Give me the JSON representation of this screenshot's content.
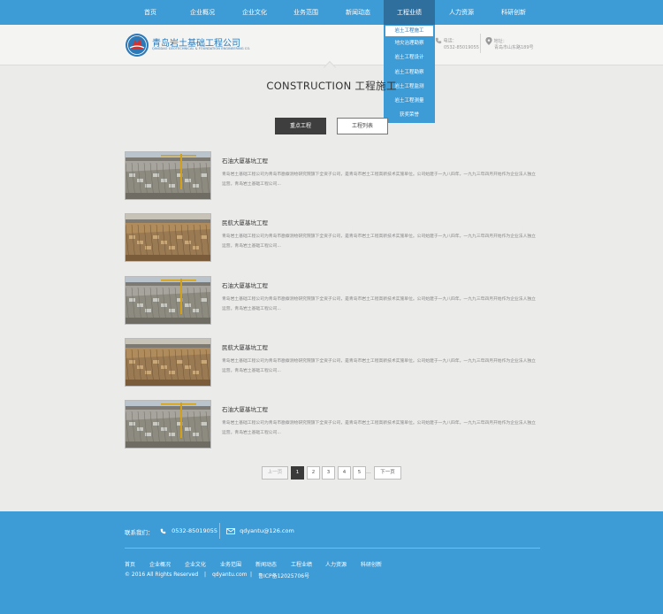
{
  "nav": {
    "items": [
      "首页",
      "企业概况",
      "企业文化",
      "业务范围",
      "新闻动态",
      "工程业绩",
      "人力资源",
      "科研创新"
    ],
    "active_index": 5,
    "dropdown": [
      "岩土工程施工",
      "地灾治理勘察",
      "岩土工程设计",
      "岩土工程勘察",
      "岩土工程监测",
      "岩土工程测量",
      "获奖荣誉"
    ],
    "dropdown_active_index": 0
  },
  "header": {
    "company_cn": "青岛岩土基础工程公司",
    "company_en": "QINGDAO GEOTECHNICAL & FOUNDATION ENGINEERING CO.",
    "phone_label": "电话：",
    "phone": "0532-85019055",
    "address_label": "地址：",
    "address": "青岛市山东路189号"
  },
  "section": {
    "title": "CONSTRUCTION 工程施工"
  },
  "tabs": [
    "重点工程",
    "工程列表"
  ],
  "projects": [
    {
      "title": "石油大厦基坑工程",
      "desc": "青岛岩土基础工程公司为青岛市勘察测绘研究院旗下全资子公司，是青岛市岩土工程高新技术实施单位。公司始建于一九八四年，一九九三年四月开始作为企业法人独立运营。青岛岩土基础工程公司..."
    },
    {
      "title": "民航大厦基坑工程",
      "desc": "青岛岩土基础工程公司为青岛市勘察测绘研究院旗下全资子公司，是青岛市岩土工程高新技术实施单位。公司始建于一九八四年，一九九三年四月开始作为企业法人独立运营。青岛岩土基础工程公司..."
    },
    {
      "title": "石油大厦基坑工程",
      "desc": "青岛岩土基础工程公司为青岛市勘察测绘研究院旗下全资子公司，是青岛市岩土工程高新技术实施单位。公司始建于一九八四年，一九九三年四月开始作为企业法人独立运营。青岛岩土基础工程公司..."
    },
    {
      "title": "民航大厦基坑工程",
      "desc": "青岛岩土基础工程公司为青岛市勘察测绘研究院旗下全资子公司，是青岛市岩土工程高新技术实施单位。公司始建于一九八四年，一九九三年四月开始作为企业法人独立运营。青岛岩土基础工程公司..."
    },
    {
      "title": "石油大厦基坑工程",
      "desc": "青岛岩土基础工程公司为青岛市勘察测绘研究院旗下全资子公司，是青岛市岩土工程高新技术实施单位。公司始建于一九八四年，一九九三年四月开始作为企业法人独立运营。青岛岩土基础工程公司..."
    }
  ],
  "pagination": {
    "prev": "上一页",
    "pages": [
      "1",
      "2",
      "3",
      "4",
      "5"
    ],
    "ellipsis": "...",
    "next": "下一页",
    "current": "1"
  },
  "footer": {
    "contact_label": "联系我们：",
    "phone": "0532-85019055",
    "email": "qdyantu@126.com",
    "nav": [
      "首页",
      "企业概况",
      "企业文化",
      "业务范围",
      "新闻动态",
      "工程业绩",
      "人力资源",
      "科研创新"
    ],
    "copyright": "© 2016 All Rights Reserved",
    "site": "qdyantu.com",
    "icp": "鲁ICP备12025706号",
    "sep": "|"
  },
  "colors": {
    "brand_blue": "#3d9bd6",
    "nav_active": "#2f6f9e",
    "page_bg": "#ebebea",
    "dark_tab": "#3e3e3e"
  },
  "icons": [
    "logo-emblem",
    "phone-icon",
    "location-pin-icon",
    "mail-icon"
  ]
}
